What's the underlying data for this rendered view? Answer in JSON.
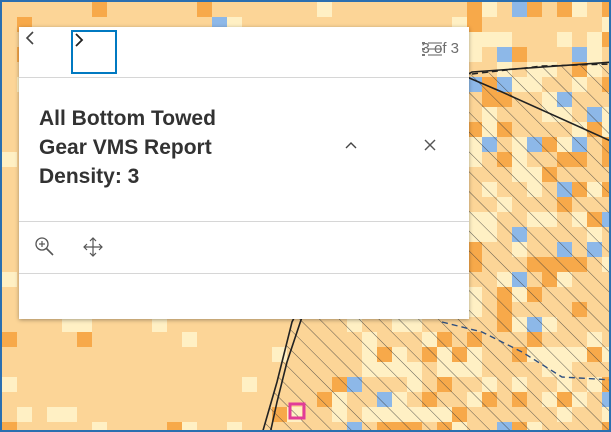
{
  "popup": {
    "prev_icon": "chevron-left-icon",
    "next_icon": "chevron-right-icon",
    "count": "3 of 3",
    "list_icon": "list-icon",
    "title_lines": [
      "All Bottom Towed",
      "Gear VMS Report",
      "Density: 3"
    ],
    "collapse_icon": "chevron-up-icon",
    "close_icon": "close-icon",
    "tools": [
      "zoom-to-icon",
      "pan-icon"
    ]
  },
  "colors": {
    "map_base": "#fcd597",
    "light_cell": "#fff0c4",
    "orange_cell": "#f7a94a",
    "blue_cell": "#8db8e8",
    "accent": "#0079c1",
    "highlight": "#e23c98"
  }
}
